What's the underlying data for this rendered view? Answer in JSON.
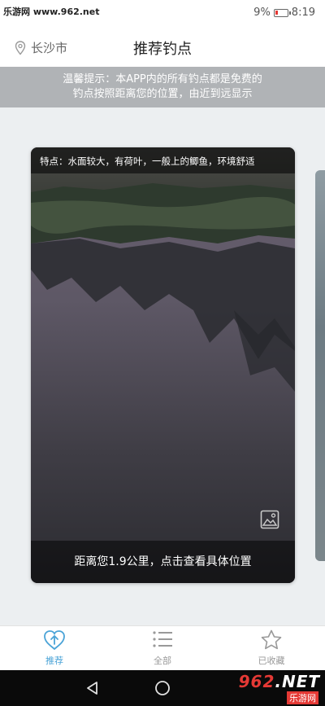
{
  "status_bar": {
    "watermark": "乐游网 www.962.net",
    "battery_percent": "9%",
    "time": "8:19"
  },
  "header": {
    "city": "长沙市",
    "title": "推荐钓点"
  },
  "notice": {
    "line1": "温馨提示：本APP内的所有钓点都是免费的",
    "line2": "钓点按照距离您的位置，由近到远显示"
  },
  "card": {
    "feature": "特点：水面较大，有荷叶，一般上的鲫鱼，环境舒适",
    "distance": "距离您1.9公里，点击查看具体位置"
  },
  "tabs": [
    {
      "label": "推荐",
      "icon": "heart-arrow-icon",
      "active": true
    },
    {
      "label": "全部",
      "icon": "list-icon",
      "active": false
    },
    {
      "label": "已收藏",
      "icon": "star-icon",
      "active": false
    }
  ],
  "watermark_bottom": {
    "brand": "962",
    "suffix": ".NET",
    "sub": "乐游网"
  },
  "colors": {
    "accent": "#4aa3d7",
    "notice_bg": "#b0b3b6"
  }
}
